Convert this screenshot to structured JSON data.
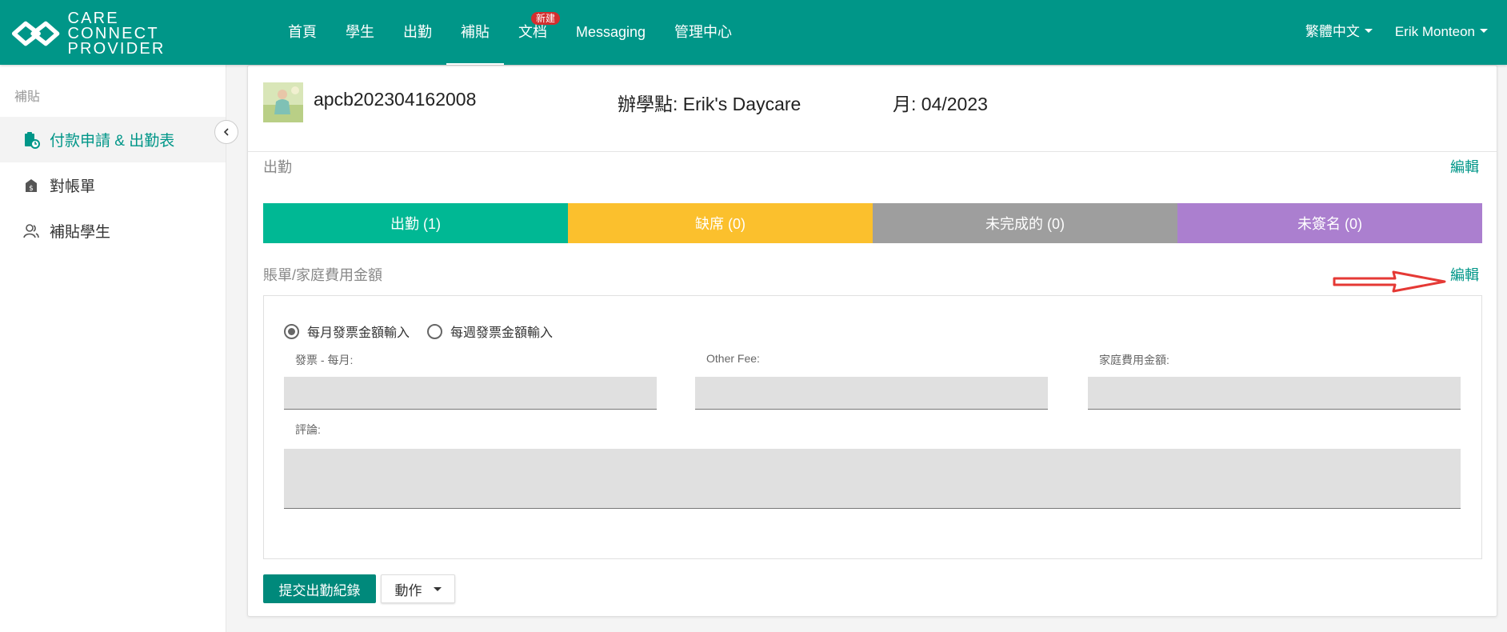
{
  "brand": {
    "line1": "CARE",
    "line2": "CONNECT PROVIDER"
  },
  "nav": {
    "items": [
      {
        "label": "首頁"
      },
      {
        "label": "學生"
      },
      {
        "label": "出勤"
      },
      {
        "label": "補貼",
        "active": true
      },
      {
        "label": "文档",
        "badge": "新建"
      },
      {
        "label": "Messaging"
      },
      {
        "label": "管理中心"
      }
    ],
    "language": "繁體中文",
    "user": "Erik Monteon"
  },
  "sidebar": {
    "title": "補貼",
    "items": [
      {
        "label": "付款申請 & 出勤表",
        "icon": "clipboard-clock-icon",
        "active": true
      },
      {
        "label": "對帳單",
        "icon": "statement-icon"
      },
      {
        "label": "補貼學生",
        "icon": "students-icon"
      }
    ]
  },
  "student": {
    "id": "apcb202304162008",
    "site_label": "辦學點: Erik's Daycare",
    "month_label": "月: 04/2023"
  },
  "attendance": {
    "title": "出勤",
    "edit": "編輯",
    "segments": [
      {
        "label": "出勤 (1)",
        "color": "#00b894"
      },
      {
        "label": "缺席 (0)",
        "color": "#fbc02d"
      },
      {
        "label": "未完成的 (0)",
        "color": "#9e9e9e"
      },
      {
        "label": "未簽名 (0)",
        "color": "#ab7fcf"
      }
    ]
  },
  "billing": {
    "title": "賬單/家庭費用金額",
    "edit": "編輯",
    "radio_monthly": "每月發票金額輸入",
    "radio_weekly": "每週發票金額輸入",
    "invoice_label": "發票 - 每月:",
    "invoice_value": "",
    "other_fee_label": "Other Fee:",
    "other_fee_value": "",
    "family_fee_label": "家庭費用金額:",
    "family_fee_value": "",
    "comment_label": "評論:",
    "comment_value": ""
  },
  "actions": {
    "submit": "提交出勤紀錄",
    "action": "動作"
  },
  "colors": {
    "primary": "#009688",
    "annotation_arrow": "#e53935"
  }
}
